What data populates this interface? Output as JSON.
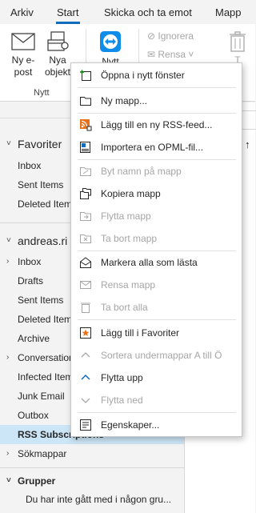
{
  "ribbon_tabs": [
    "Arkiv",
    "Start",
    "Skicka och ta emot",
    "Mapp"
  ],
  "ribbon": {
    "new_email": [
      "Ny e-",
      "post"
    ],
    "new_items": [
      "Nya",
      "objekt"
    ],
    "teamviewer": [
      "Nytt"
    ],
    "group_new": "Nytt",
    "ignore": "Ignorera",
    "clean": "Rensa",
    "delete_short": "T"
  },
  "folders": {
    "favorites_header": "Favoriter",
    "favorites": [
      "Inbox",
      "Sent Items",
      "Deleted Items"
    ],
    "account_header": "andreas.ri",
    "inbox": "Inbox",
    "items": [
      "Drafts",
      "Sent Items",
      "Deleted Items",
      "Archive"
    ],
    "conversation": "Conversation",
    "items2": [
      "Infected Items",
      "Junk Email",
      "Outbox"
    ],
    "rss": "RSS Subscriptions",
    "search": "Sökmappar",
    "groups_header": "Grupper",
    "groups_note": "Du har inte gått med i någon gru..."
  },
  "right_strip": {
    "sort_arrow": "↑"
  },
  "context_menu": [
    {
      "label": "Öppna i nytt fönster",
      "icon": "open-new-window-icon",
      "disabled": false
    },
    {
      "label": "Ny mapp...",
      "icon": "new-folder-icon",
      "disabled": false
    },
    {
      "label": "Lägg till en ny RSS-feed...",
      "icon": "rss-icon",
      "disabled": false
    },
    {
      "label": "Importera en OPML-fil...",
      "icon": "import-opml-icon",
      "disabled": false
    },
    {
      "label": "Byt namn på mapp",
      "icon": "rename-folder-icon",
      "disabled": true
    },
    {
      "label": "Kopiera mapp",
      "icon": "copy-folder-icon",
      "disabled": false
    },
    {
      "label": "Flytta mapp",
      "icon": "move-folder-icon",
      "disabled": true
    },
    {
      "label": "Ta bort mapp",
      "icon": "delete-folder-icon",
      "disabled": true
    },
    {
      "label": "Markera alla som lästa",
      "icon": "mark-read-icon",
      "disabled": false
    },
    {
      "label": "Rensa mapp",
      "icon": "clean-folder-icon",
      "disabled": true
    },
    {
      "label": "Ta bort alla",
      "icon": "delete-all-icon",
      "disabled": true
    },
    {
      "label": "Lägg till i Favoriter",
      "icon": "add-favorite-icon",
      "disabled": false
    },
    {
      "label": "Sortera undermappar A till Ö",
      "icon": "sort-icon",
      "disabled": true
    },
    {
      "label": "Flytta upp",
      "icon": "move-up-icon",
      "disabled": false
    },
    {
      "label": "Flytta ned",
      "icon": "move-down-icon",
      "disabled": true
    },
    {
      "label": "Egenskaper...",
      "icon": "properties-icon",
      "disabled": false
    }
  ],
  "colors": {
    "accent": "#0f6cbd",
    "rss_orange": "#e8711c",
    "selected_bg": "#cde6f7",
    "disabled_text": "#a6a6a6"
  }
}
